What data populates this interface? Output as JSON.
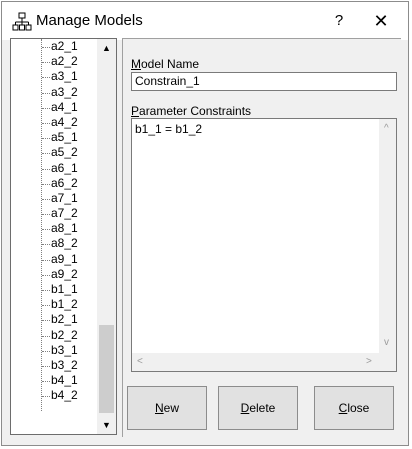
{
  "window": {
    "title": "Manage Models",
    "help_label": "?",
    "close_label": "✕"
  },
  "tree": {
    "items": [
      "a2_1",
      "a2_2",
      "a3_1",
      "a3_2",
      "a4_1",
      "a4_2",
      "a5_1",
      "a5_2",
      "a6_1",
      "a6_2",
      "a7_1",
      "a7_2",
      "a8_1",
      "a8_2",
      "a9_1",
      "a9_2",
      "b1_1",
      "b1_2",
      "b2_1",
      "b2_2",
      "b3_1",
      "b3_2",
      "b4_1",
      "b4_2"
    ],
    "scroll_up": "▲",
    "scroll_down": "▼"
  },
  "form": {
    "model_name_label_first": "M",
    "model_name_label_rest": "odel Name",
    "model_name_value": "Constrain_1",
    "constraints_label_first": "P",
    "constraints_label_rest": "arameter Constraints",
    "constraints_value": "b1_1 = b1_2"
  },
  "buttons": {
    "new_first": "N",
    "new_rest": "ew",
    "delete_first": "D",
    "delete_rest": "elete",
    "close_first": "C",
    "close_rest": "lose"
  },
  "text_scroll": {
    "up": "^",
    "down": "v",
    "left": "<",
    "right": ">"
  }
}
